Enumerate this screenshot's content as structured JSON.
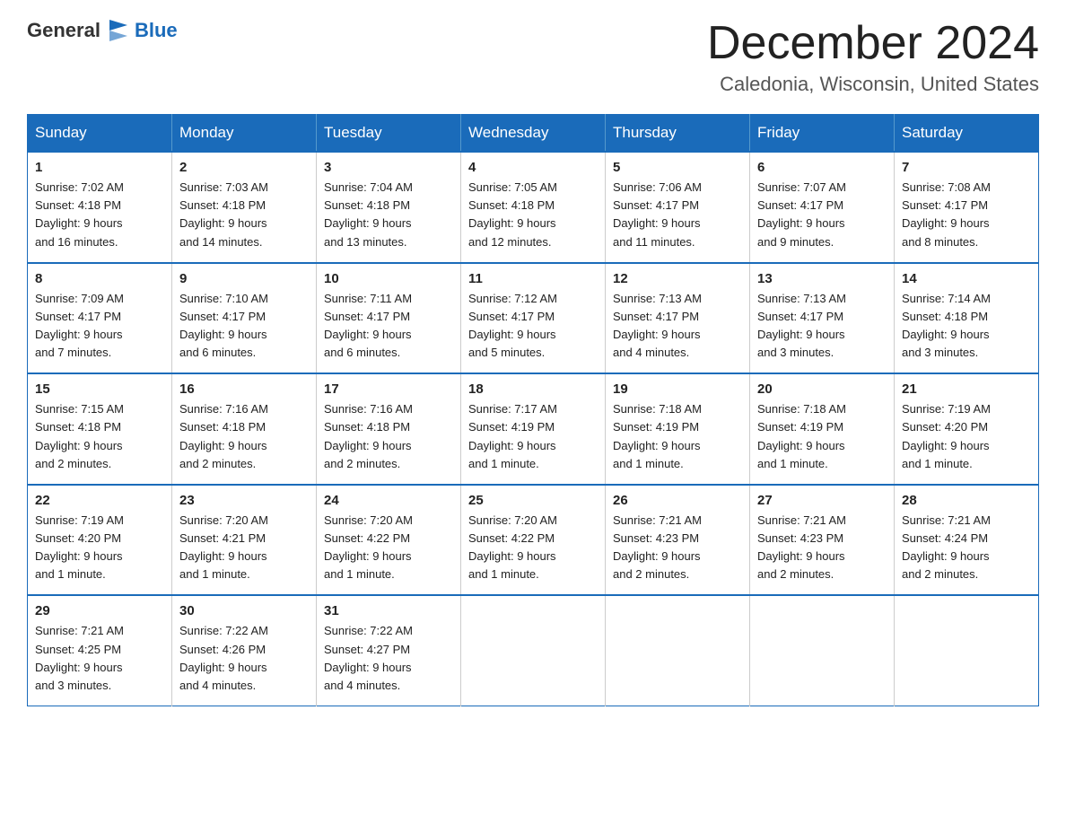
{
  "header": {
    "logo_general": "General",
    "logo_blue": "Blue",
    "month_year": "December 2024",
    "location": "Caledonia, Wisconsin, United States"
  },
  "days_of_week": [
    "Sunday",
    "Monday",
    "Tuesday",
    "Wednesday",
    "Thursday",
    "Friday",
    "Saturday"
  ],
  "weeks": [
    [
      {
        "day": "1",
        "sunrise": "7:02 AM",
        "sunset": "4:18 PM",
        "daylight": "9 hours and 16 minutes."
      },
      {
        "day": "2",
        "sunrise": "7:03 AM",
        "sunset": "4:18 PM",
        "daylight": "9 hours and 14 minutes."
      },
      {
        "day": "3",
        "sunrise": "7:04 AM",
        "sunset": "4:18 PM",
        "daylight": "9 hours and 13 minutes."
      },
      {
        "day": "4",
        "sunrise": "7:05 AM",
        "sunset": "4:18 PM",
        "daylight": "9 hours and 12 minutes."
      },
      {
        "day": "5",
        "sunrise": "7:06 AM",
        "sunset": "4:17 PM",
        "daylight": "9 hours and 11 minutes."
      },
      {
        "day": "6",
        "sunrise": "7:07 AM",
        "sunset": "4:17 PM",
        "daylight": "9 hours and 9 minutes."
      },
      {
        "day": "7",
        "sunrise": "7:08 AM",
        "sunset": "4:17 PM",
        "daylight": "9 hours and 8 minutes."
      }
    ],
    [
      {
        "day": "8",
        "sunrise": "7:09 AM",
        "sunset": "4:17 PM",
        "daylight": "9 hours and 7 minutes."
      },
      {
        "day": "9",
        "sunrise": "7:10 AM",
        "sunset": "4:17 PM",
        "daylight": "9 hours and 6 minutes."
      },
      {
        "day": "10",
        "sunrise": "7:11 AM",
        "sunset": "4:17 PM",
        "daylight": "9 hours and 6 minutes."
      },
      {
        "day": "11",
        "sunrise": "7:12 AM",
        "sunset": "4:17 PM",
        "daylight": "9 hours and 5 minutes."
      },
      {
        "day": "12",
        "sunrise": "7:13 AM",
        "sunset": "4:17 PM",
        "daylight": "9 hours and 4 minutes."
      },
      {
        "day": "13",
        "sunrise": "7:13 AM",
        "sunset": "4:17 PM",
        "daylight": "9 hours and 3 minutes."
      },
      {
        "day": "14",
        "sunrise": "7:14 AM",
        "sunset": "4:18 PM",
        "daylight": "9 hours and 3 minutes."
      }
    ],
    [
      {
        "day": "15",
        "sunrise": "7:15 AM",
        "sunset": "4:18 PM",
        "daylight": "9 hours and 2 minutes."
      },
      {
        "day": "16",
        "sunrise": "7:16 AM",
        "sunset": "4:18 PM",
        "daylight": "9 hours and 2 minutes."
      },
      {
        "day": "17",
        "sunrise": "7:16 AM",
        "sunset": "4:18 PM",
        "daylight": "9 hours and 2 minutes."
      },
      {
        "day": "18",
        "sunrise": "7:17 AM",
        "sunset": "4:19 PM",
        "daylight": "9 hours and 1 minute."
      },
      {
        "day": "19",
        "sunrise": "7:18 AM",
        "sunset": "4:19 PM",
        "daylight": "9 hours and 1 minute."
      },
      {
        "day": "20",
        "sunrise": "7:18 AM",
        "sunset": "4:19 PM",
        "daylight": "9 hours and 1 minute."
      },
      {
        "day": "21",
        "sunrise": "7:19 AM",
        "sunset": "4:20 PM",
        "daylight": "9 hours and 1 minute."
      }
    ],
    [
      {
        "day": "22",
        "sunrise": "7:19 AM",
        "sunset": "4:20 PM",
        "daylight": "9 hours and 1 minute."
      },
      {
        "day": "23",
        "sunrise": "7:20 AM",
        "sunset": "4:21 PM",
        "daylight": "9 hours and 1 minute."
      },
      {
        "day": "24",
        "sunrise": "7:20 AM",
        "sunset": "4:22 PM",
        "daylight": "9 hours and 1 minute."
      },
      {
        "day": "25",
        "sunrise": "7:20 AM",
        "sunset": "4:22 PM",
        "daylight": "9 hours and 1 minute."
      },
      {
        "day": "26",
        "sunrise": "7:21 AM",
        "sunset": "4:23 PM",
        "daylight": "9 hours and 2 minutes."
      },
      {
        "day": "27",
        "sunrise": "7:21 AM",
        "sunset": "4:23 PM",
        "daylight": "9 hours and 2 minutes."
      },
      {
        "day": "28",
        "sunrise": "7:21 AM",
        "sunset": "4:24 PM",
        "daylight": "9 hours and 2 minutes."
      }
    ],
    [
      {
        "day": "29",
        "sunrise": "7:21 AM",
        "sunset": "4:25 PM",
        "daylight": "9 hours and 3 minutes."
      },
      {
        "day": "30",
        "sunrise": "7:22 AM",
        "sunset": "4:26 PM",
        "daylight": "9 hours and 4 minutes."
      },
      {
        "day": "31",
        "sunrise": "7:22 AM",
        "sunset": "4:27 PM",
        "daylight": "9 hours and 4 minutes."
      },
      null,
      null,
      null,
      null
    ]
  ],
  "labels": {
    "sunrise": "Sunrise:",
    "sunset": "Sunset:",
    "daylight": "Daylight:"
  }
}
